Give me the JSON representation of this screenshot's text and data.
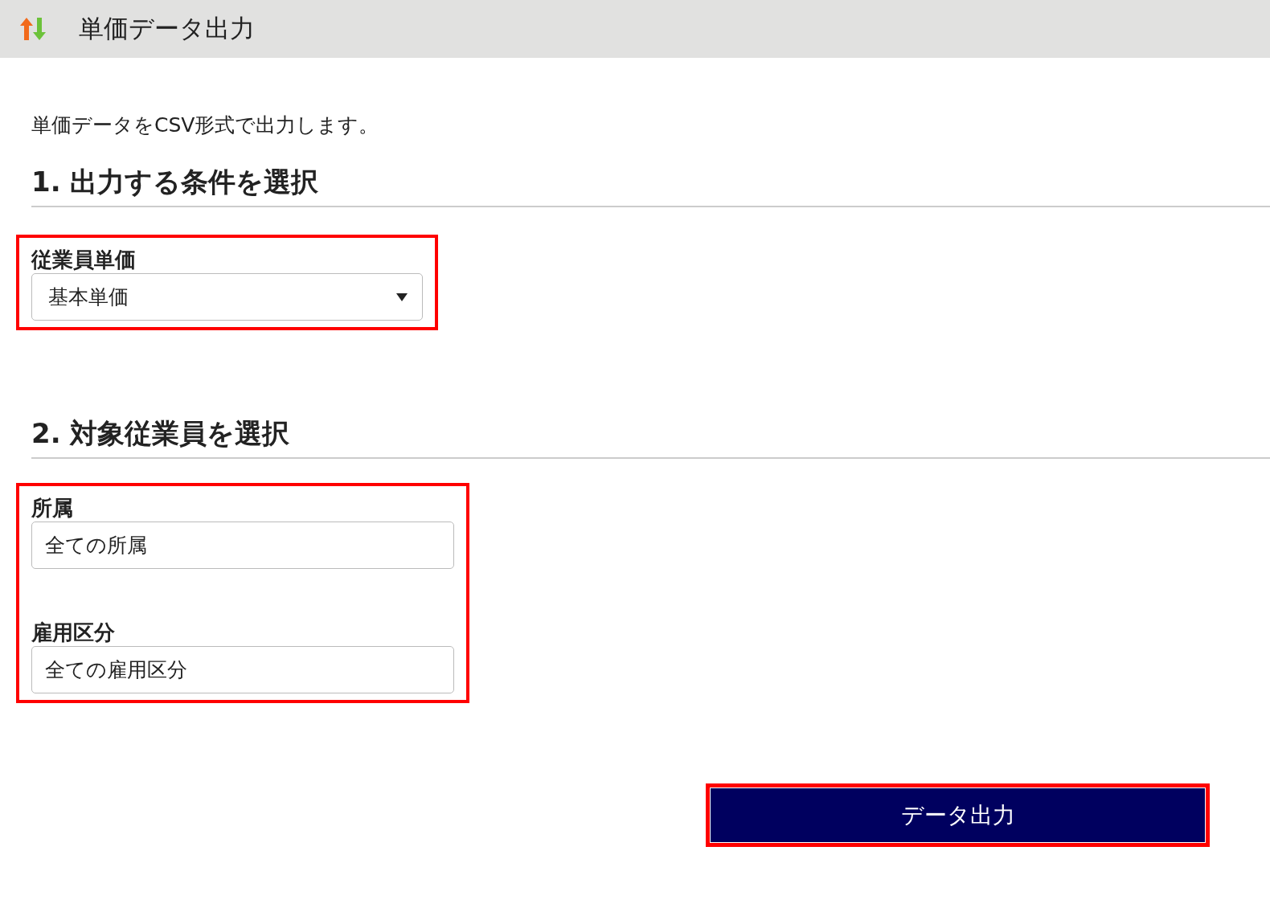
{
  "header": {
    "title": "単価データ出力"
  },
  "description": "単価データをCSV形式で出力します。",
  "sections": [
    {
      "heading": "1. 出力する条件を選択",
      "highlighted": true,
      "fields": [
        {
          "kind": "select",
          "label": "従業員単価",
          "value": "基本単価"
        }
      ]
    },
    {
      "heading": "2. 対象従業員を選択",
      "highlighted": true,
      "fields": [
        {
          "kind": "input",
          "label": "所属",
          "value": "全ての所属"
        },
        {
          "kind": "input",
          "label": "雇用区分",
          "value": "全ての雇用区分"
        }
      ]
    }
  ],
  "submit": {
    "label": "データ出力",
    "highlighted": true
  }
}
